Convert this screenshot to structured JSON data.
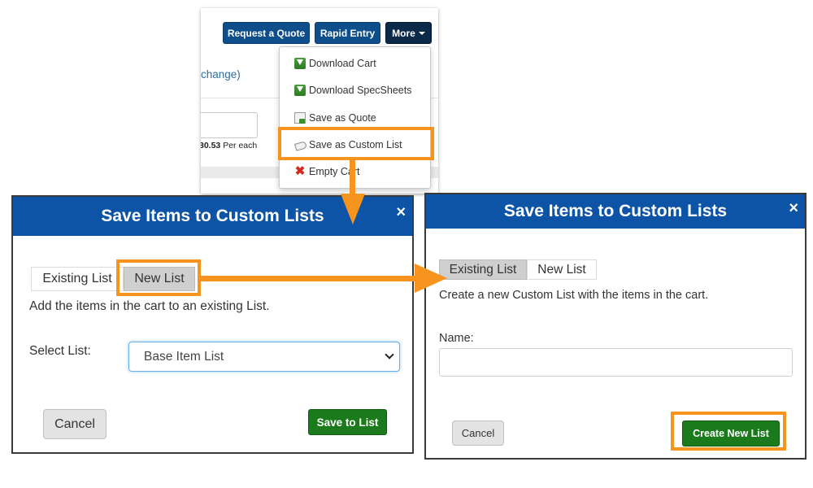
{
  "cart": {
    "change_link": "change)",
    "price": "30.53",
    "price_unit": "Per each",
    "buttons": {
      "request_quote": "Request a Quote",
      "rapid_entry": "Rapid Entry",
      "more": "More"
    },
    "more_menu": [
      {
        "label": "Download Cart",
        "icon": "download-icon"
      },
      {
        "label": "Download SpecSheets",
        "icon": "download-icon"
      },
      {
        "label": "Save as Quote",
        "icon": "document-icon"
      },
      {
        "label": "Save as Custom List",
        "icon": "list-icon"
      },
      {
        "label": "Empty Cart",
        "icon": "red-x-icon"
      }
    ]
  },
  "existing_modal": {
    "title": "Save Items to Custom Lists",
    "close": "×",
    "tabs": [
      "Existing List",
      "New List"
    ],
    "description": "Add the items in the cart to an existing List.",
    "select_label": "Select List:",
    "select_value": "Base Item List",
    "cancel": "Cancel",
    "submit": "Save to List"
  },
  "new_modal": {
    "title": "Save Items to Custom Lists",
    "close": "×",
    "tabs": [
      "Existing List",
      "New List"
    ],
    "description": "Create a new Custom List with the items in the cart.",
    "name_label": "Name:",
    "name_value": "",
    "cancel": "Cancel",
    "submit": "Create New List"
  },
  "colors": {
    "header_blue": "#0e54a6",
    "nav_blue": "#0e4f8b",
    "green_button": "#1b7a1b",
    "highlight_orange": "#f7941d"
  }
}
